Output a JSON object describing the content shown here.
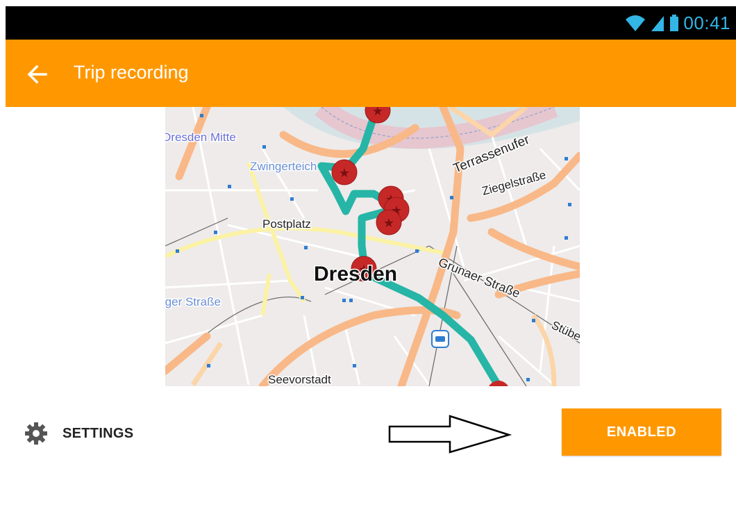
{
  "status_bar": {
    "time": "00:41"
  },
  "app_bar": {
    "title": "Trip recording",
    "back_icon": "arrow-left-icon"
  },
  "map": {
    "labels": {
      "dresden_mitte": "Dresden Mitte",
      "zwingerteich": "Zwingerteich",
      "terrassenufer": "Terrassenufer",
      "ziegelstrasse": "Ziegelstraße",
      "postplatz": "Postplatz",
      "dresden": "Dresden",
      "grunaer_strasse": "Grunaer Straße",
      "berger_strasse": "rger Straße",
      "seevorstadt": "Seevorstadt",
      "stuebel": "Stübe"
    },
    "colors": {
      "track": "#26b5a6",
      "marker": "#c62828",
      "road_major": "#f9b888",
      "road_yellow": "#fbf2a5"
    }
  },
  "settings": {
    "label": "SETTINGS",
    "icon": "gear-icon"
  },
  "action": {
    "enabled_label": "ENABLED"
  },
  "colors": {
    "accent": "#ff9800",
    "status_bar": "#000000"
  }
}
